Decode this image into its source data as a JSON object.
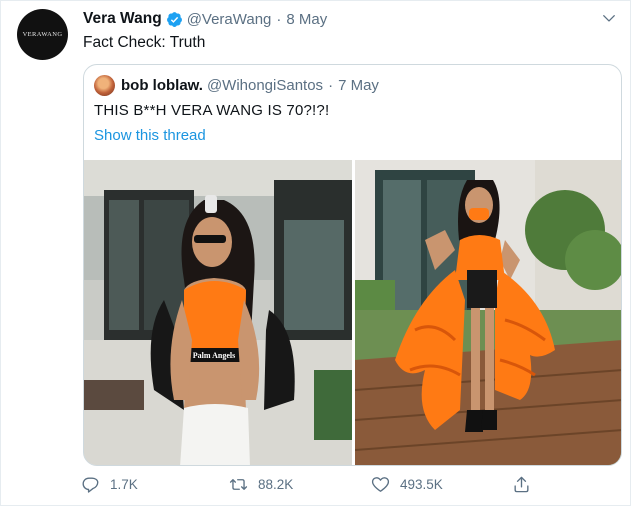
{
  "author": {
    "avatar_text": "VERAWANG",
    "name": "Vera Wang",
    "handle": "@VeraWang",
    "separator": "·",
    "date": "8 May",
    "text": "Fact Check: Truth"
  },
  "quoted": {
    "name": "bob loblaw.",
    "handle": "@WihongiSantos",
    "separator": "·",
    "date": "7 May",
    "text": "THIS B**H VERA WANG IS 70?!?!",
    "show_thread": "Show this thread",
    "top_label": "Palm Angels"
  },
  "actions": {
    "reply_count": "1.7K",
    "retweet_count": "88.2K",
    "like_count": "493.5K"
  },
  "colors": {
    "link": "#1b95e0",
    "muted": "#5b7083",
    "verified": "#1da1f2",
    "orange": "#ff7a14"
  }
}
